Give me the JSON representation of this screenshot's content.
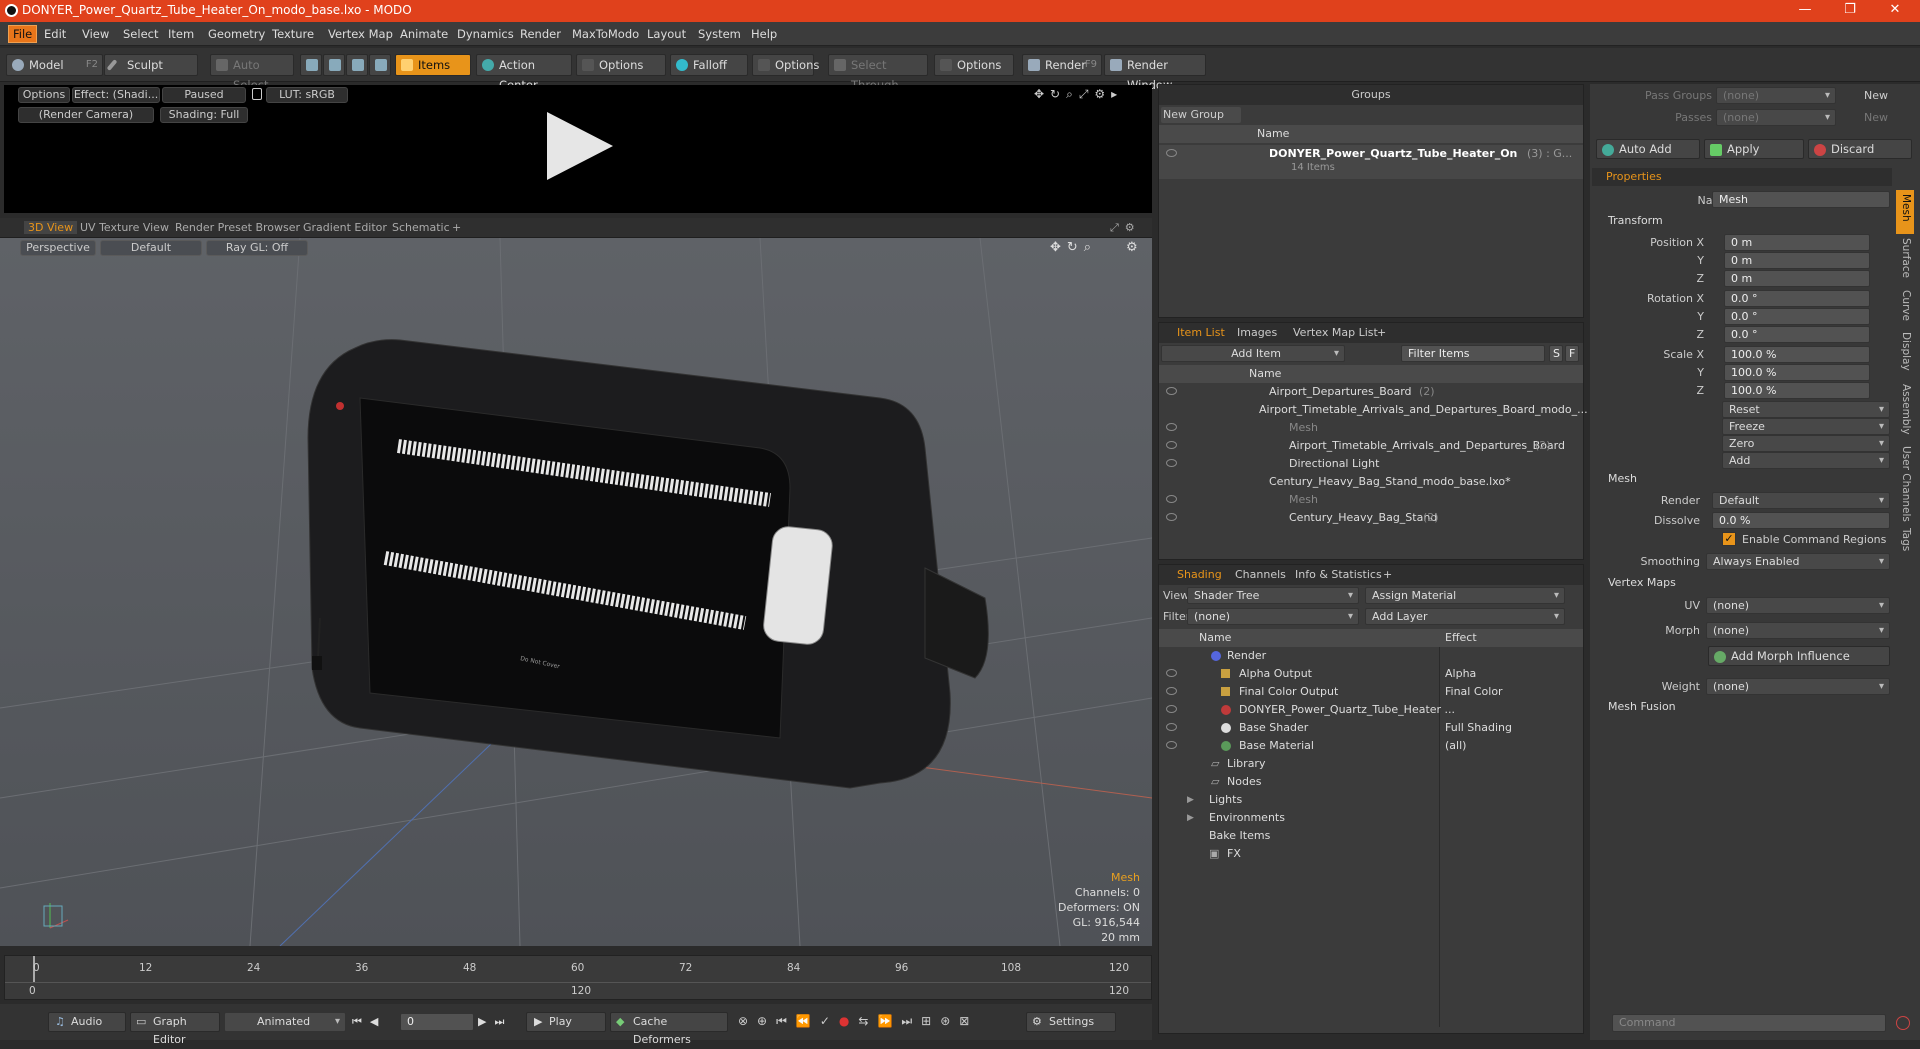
{
  "title": "DONYER_Power_Quartz_Tube_Heater_On_modo_base.lxo - MODO",
  "menu": [
    "File",
    "Edit",
    "View",
    "Select",
    "Item",
    "Geometry",
    "Texture",
    "Vertex Map",
    "Animate",
    "Dynamics",
    "Render",
    "MaxToModo",
    "Layout",
    "System",
    "Help"
  ],
  "toolbar": {
    "model": "Model",
    "model_key": "F2",
    "sculpt": "Sculpt",
    "auto_select": "Auto Select",
    "items": "Items",
    "action_center": "Action Center",
    "options1": "Options",
    "falloff": "Falloff",
    "options2": "Options",
    "select_through": "Select Through",
    "options3": "Options",
    "render": "Render",
    "render_key": "F9",
    "render_window": "Render Window"
  },
  "preview": {
    "options": "Options",
    "effect": "Effect: (Shadi...",
    "paused": "Paused",
    "lut": "LUT: sRGB",
    "camera": "(Render Camera)",
    "shading": "Shading: Full"
  },
  "view_tabs": [
    "3D View",
    "UV Texture View",
    "Render Preset Browser",
    "Gradient Editor",
    "Schematic",
    "+"
  ],
  "viewport": {
    "perspective": "Perspective",
    "default": "Default",
    "raygl": "Ray GL: Off",
    "label_text": "Do Not Cover",
    "info_title": "Mesh",
    "channels": "Channels: 0",
    "deformers": "Deformers: ON",
    "gl": "GL: 916,544",
    "size": "20 mm"
  },
  "timeline": {
    "ticks": [
      "0",
      "12",
      "24",
      "36",
      "48",
      "60",
      "72",
      "84",
      "96",
      "108",
      "120"
    ],
    "lower": [
      "0",
      "120",
      "120"
    ]
  },
  "bottom": {
    "audio": "Audio",
    "graph": "Graph Editor",
    "animated": "Animated",
    "frame": "0",
    "play": "Play",
    "cache": "Cache Deformers",
    "settings": "Settings"
  },
  "groups": {
    "title": "Groups",
    "new_group": "New Group",
    "name_col": "Name",
    "item": "DONYER_Power_Quartz_Tube_Heater_On",
    "item_count": "(3) : G...",
    "sub": "14 Items"
  },
  "itemlist": {
    "tabs": [
      "Item List",
      "Images",
      "Vertex Map List",
      "+"
    ],
    "add_item": "Add Item",
    "filter": "Filter Items",
    "s": "S",
    "f": "F",
    "name_col": "Name",
    "rows": [
      {
        "label": "Airport_Departures_Board",
        "count": "(2)"
      },
      {
        "label": "Airport_Timetable_Arrivals_and_Departures_Board_modo_...",
        "count": ""
      },
      {
        "label": "Mesh",
        "count": ""
      },
      {
        "label": "Airport_Timetable_Arrivals_and_Departures_Board",
        "count": "(2)"
      },
      {
        "label": "Directional Light",
        "count": ""
      },
      {
        "label": "Century_Heavy_Bag_Stand_modo_base.lxo*",
        "count": ""
      },
      {
        "label": "Mesh",
        "count": ""
      },
      {
        "label": "Century_Heavy_Bag_Stand",
        "count": "(2)"
      }
    ]
  },
  "shading": {
    "tabs": [
      "Shading",
      "Channels",
      "Info & Statistics",
      "+"
    ],
    "view_lbl": "View",
    "view_val": "Shader Tree",
    "assign": "Assign Material",
    "filter_lbl": "Filter",
    "filter_val": "(none)",
    "add_layer": "Add Layer",
    "col_name": "Name",
    "col_effect": "Effect",
    "rows": [
      {
        "name": "Render",
        "effect": ""
      },
      {
        "name": "Alpha Output",
        "effect": "Alpha"
      },
      {
        "name": "Final Color Output",
        "effect": "Final Color"
      },
      {
        "name": "DONYER_Power_Quartz_Tube_Heater ...",
        "effect": ""
      },
      {
        "name": "Base Shader",
        "effect": "Full Shading"
      },
      {
        "name": "Base Material",
        "effect": "(all)"
      },
      {
        "name": "Library",
        "effect": ""
      },
      {
        "name": "Nodes",
        "effect": ""
      },
      {
        "name": "Lights",
        "effect": ""
      },
      {
        "name": "Environments",
        "effect": ""
      },
      {
        "name": "Bake Items",
        "effect": ""
      },
      {
        "name": "FX",
        "effect": ""
      }
    ]
  },
  "props": {
    "pass_groups": "Pass Groups",
    "passes": "Passes",
    "none": "(none)",
    "new": "New",
    "auto_add": "Auto Add",
    "apply": "Apply",
    "discard": "Discard",
    "tab": "Properties",
    "name_lbl": "Name",
    "name_val": "Mesh",
    "transform": "Transform",
    "pos_lbl": "Position X",
    "y": "Y",
    "z": "Z",
    "pos": [
      "0 m",
      "0 m",
      "0 m"
    ],
    "rot_lbl": "Rotation X",
    "rot": [
      "0.0 °",
      "0.0 °",
      "0.0 °"
    ],
    "scale_lbl": "Scale X",
    "scale": [
      "100.0 %",
      "100.0 %",
      "100.0 %"
    ],
    "reset": "Reset",
    "freeze": "Freeze",
    "zero": "Zero",
    "add": "Add",
    "mesh": "Mesh",
    "render_lbl": "Render",
    "render_val": "Default",
    "dissolve_lbl": "Dissolve",
    "dissolve_val": "0.0 %",
    "enable_cmd": "Enable Command Regions",
    "smoothing_lbl": "Smoothing",
    "smoothing_val": "Always Enabled",
    "vertex_maps": "Vertex Maps",
    "uv_lbl": "UV",
    "morph_lbl": "Morph",
    "add_morph": "Add Morph Influence",
    "weight_lbl": "Weight",
    "mesh_fusion": "Mesh Fusion",
    "side_tabs": [
      "Mesh",
      "Surface",
      "Curve",
      "Display",
      "Assembly",
      "User Channels",
      "Tags"
    ],
    "command": "Command"
  }
}
